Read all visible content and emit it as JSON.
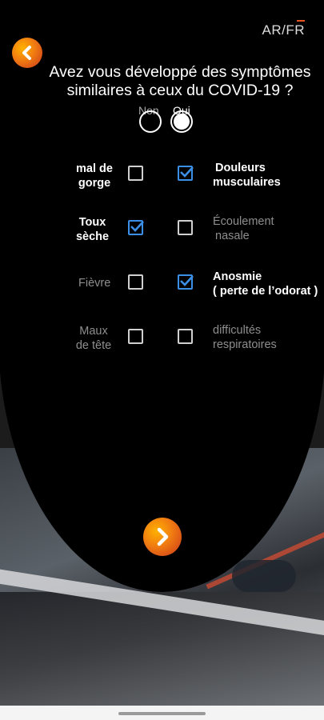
{
  "header": {
    "language_toggle": "AR/FR"
  },
  "question": "Avez vous développé des symptômes similaires à ceux du COVID-19 ?",
  "radio": {
    "no_label": "Non",
    "yes_label": "Oui",
    "selected": "Oui"
  },
  "symptoms": {
    "left": [
      {
        "label_line1": "mal de",
        "label_line2": "gorge",
        "checked": false
      },
      {
        "label_line1": "Toux",
        "label_line2": "sèche",
        "checked": true
      },
      {
        "label_line1": "Fièvre",
        "label_line2": "",
        "checked": false
      },
      {
        "label_line1": "Maux",
        "label_line2": "de tête",
        "checked": false
      }
    ],
    "right": [
      {
        "label_line1": "Douleurs",
        "label_line2": "musculaires",
        "checked": true
      },
      {
        "label_line1": "Écoulement",
        "label_line2": "nasale",
        "checked": false
      },
      {
        "label_line1": "Anosmie",
        "label_line2": "( perte de l’odorat )",
        "checked": true
      },
      {
        "label_line1": "difficultés",
        "label_line2": "respiratoires",
        "checked": false
      }
    ]
  },
  "colors": {
    "accent_orange": "#f07a12",
    "checkbox_blue": "#3b8fe6"
  },
  "icons": {
    "back": "chevron-left-icon",
    "next": "chevron-right-icon"
  }
}
